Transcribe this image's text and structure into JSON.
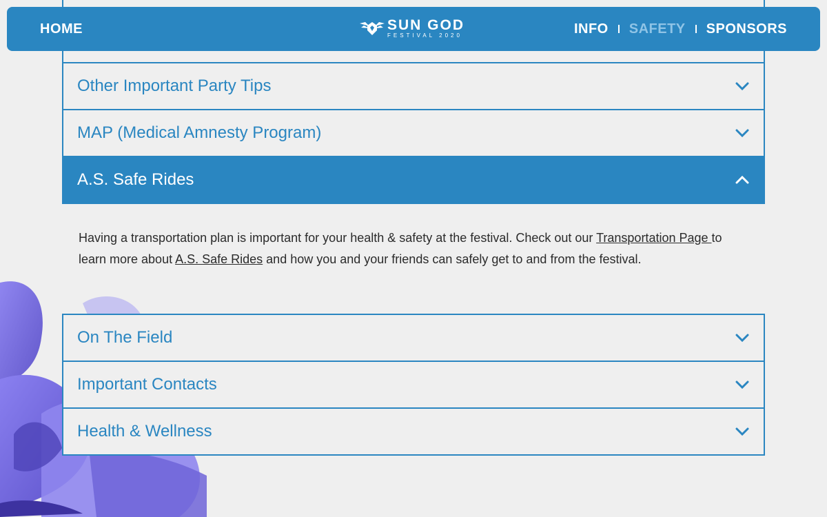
{
  "header": {
    "home_label": "HOME",
    "logo_title": "SUN GOD",
    "logo_subtitle": "FESTIVAL 2020",
    "nav": [
      {
        "label": "INFO",
        "active": false
      },
      {
        "label": "SAFETY",
        "active": true
      },
      {
        "label": "SPONSORS",
        "active": false
      }
    ]
  },
  "accordion": {
    "items_top": [
      {
        "label": "Other Important Party Tips",
        "expanded": false
      },
      {
        "label": "MAP (Medical Amnesty Program)",
        "expanded": false
      },
      {
        "label": "A.S. Safe Rides",
        "expanded": true
      }
    ],
    "open_content": {
      "text_1": "Having a transportation plan is important for your health & safety at the festival. Check out our ",
      "link_1": "Transportation Page ",
      "text_2": "to learn more about ",
      "link_2": "A.S. Safe Rides",
      "text_3": " and how you and your friends can safely get to and from the festival."
    },
    "items_bottom": [
      {
        "label": "On The Field",
        "expanded": false
      },
      {
        "label": "Important Contacts",
        "expanded": false
      },
      {
        "label": "Health & Wellness",
        "expanded": false
      }
    ]
  },
  "colors": {
    "brand_blue": "#2a86c1",
    "active_nav": "#8fc4e6",
    "background": "#efefef",
    "flower": "#7b6fe0"
  },
  "icons": [
    "sun-god-logo-icon",
    "chevron-down-icon",
    "chevron-up-icon",
    "iris-flower-image"
  ]
}
